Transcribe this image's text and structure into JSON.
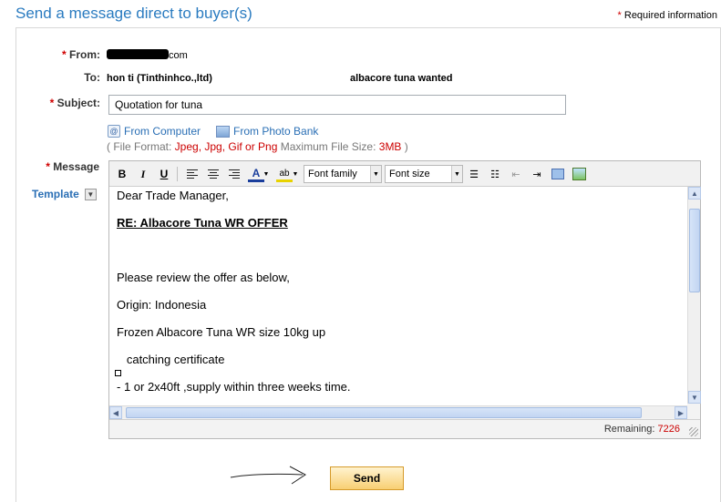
{
  "page": {
    "title": "Send a message direct to buyer(s)",
    "required_star": "*",
    "required_info": "Required information"
  },
  "form": {
    "from_label": "From:",
    "from_value_suffix": "com",
    "to_label": "To:",
    "to_value": "hon ti (Tinthinhco.,ltd)",
    "to_subject_ref": "albacore tuna wanted",
    "subject_label": "Subject:",
    "subject_value": "Quotation for tuna",
    "attach_computer": "From Computer",
    "attach_photo_bank": "From Photo Bank",
    "file_format_prefix": "( File Format: ",
    "file_formats": "Jpeg, Jpg, Gif or Png",
    "max_size_label": " Maximum File Size: ",
    "max_size": "3MB",
    "file_format_suffix": " )",
    "message_label": "Message",
    "template_label": "Template"
  },
  "toolbar": {
    "bold": "B",
    "italic": "I",
    "underline": "U",
    "font_color": "A",
    "highlight": "ab",
    "font_family": "Font family",
    "font_size": "Font size"
  },
  "message_body": {
    "greeting": "Dear Trade Manager,",
    "re_line": "RE:  Albacore Tuna WR OFFER",
    "line1": "Please review the offer as below,",
    "line2": "Origin: Indonesia",
    "line3": "Frozen Albacore Tuna WR size 10kg up",
    "line4": "   catching certificate",
    "line5": "- 1 or 2x40ft ,supply within three weeks time."
  },
  "status": {
    "remaining_label": "Remaining:",
    "remaining_count": "7226"
  },
  "actions": {
    "send_label": "Send"
  },
  "colors": {
    "title_blue": "#2a7bc0",
    "link_blue": "#2a6fb5",
    "required_red": "#d00000",
    "send_button": "#f8cf73"
  }
}
